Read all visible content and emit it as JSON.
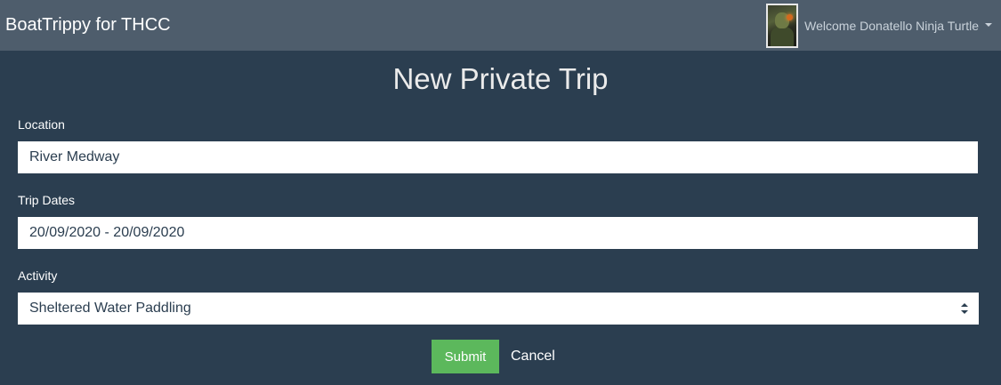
{
  "navbar": {
    "brand": "BoatTrippy for THCC",
    "user_welcome": "Welcome Donatello Ninja Turtle"
  },
  "page": {
    "title": "New Private Trip"
  },
  "form": {
    "location": {
      "label": "Location",
      "value": "River Medway"
    },
    "trip_dates": {
      "label": "Trip Dates",
      "value": "20/09/2020 - 20/09/2020"
    },
    "activity": {
      "label": "Activity",
      "selected": "Sheltered Water Paddling"
    },
    "submit_label": "Submit",
    "cancel_label": "Cancel"
  },
  "colors": {
    "background": "#2b3e50",
    "navbar": "#4e5d6c",
    "submit": "#5cb85c"
  }
}
